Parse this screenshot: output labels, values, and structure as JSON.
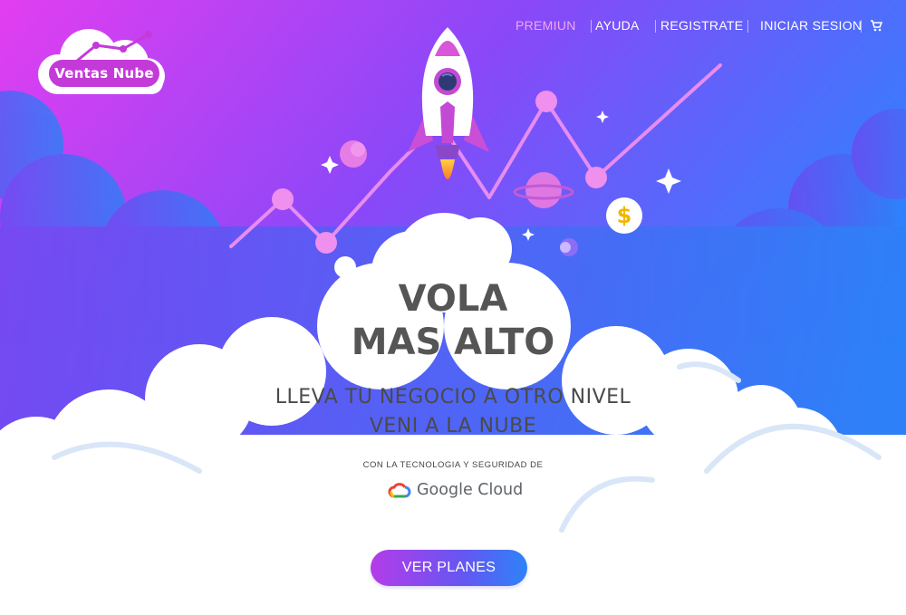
{
  "brand": {
    "logo_text": "Ventas Nube"
  },
  "nav": {
    "items": [
      {
        "label": "PREMIUN",
        "active": true
      },
      {
        "label": "AYUDA"
      },
      {
        "label": "REGISTRATE"
      },
      {
        "label": "INICIAR SESION"
      }
    ],
    "cart_icon": "cart-icon"
  },
  "hero": {
    "headline_line1": "VOLA",
    "headline_line2": "MAS ALTO",
    "sub_line1": "LLEVA TU NEGOCIO A OTRO NIVEL",
    "sub_line2": "VENI A LA NUBE",
    "tech_label": "CON LA TECNOLOGIA Y SEGURIDAD DE",
    "partner_name": "Google Cloud",
    "cta_label": "VER PLANES",
    "coin_symbol": "$"
  },
  "colors": {
    "gradient_start": "#e23ef0",
    "gradient_mid": "#7c4dff",
    "gradient_end": "#1f8bff",
    "accent": "#c43ad9",
    "headline_text": "#555555",
    "active_nav": "#f0a8f2"
  }
}
